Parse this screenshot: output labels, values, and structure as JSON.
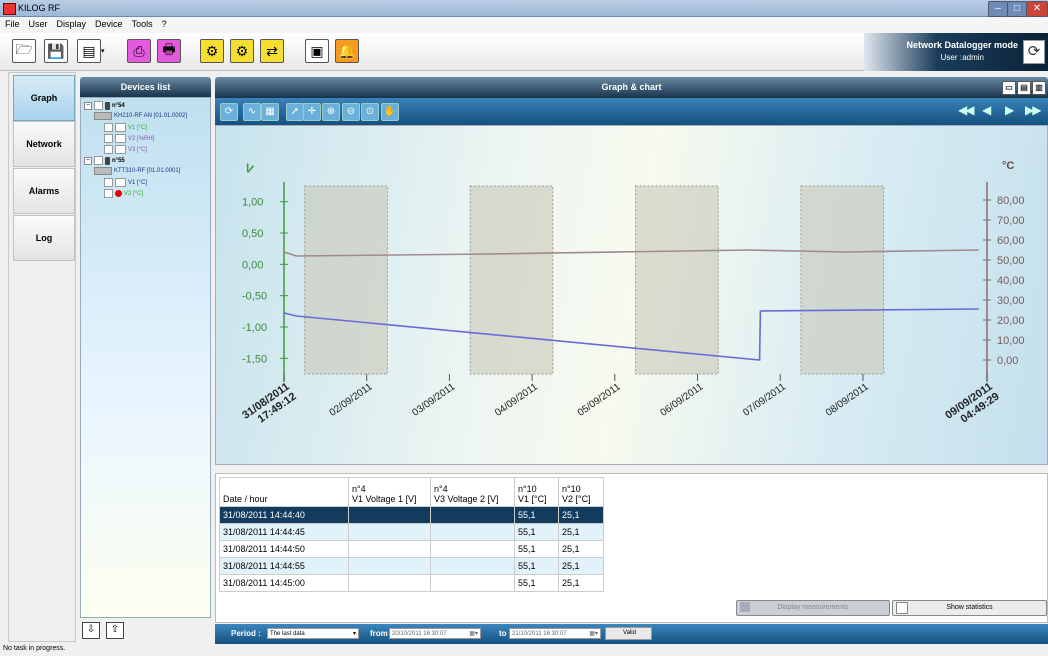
{
  "window": {
    "title": "KILOG RF",
    "buttons": [
      "–",
      "□",
      "✕"
    ]
  },
  "menu": [
    "File",
    "User",
    "Display",
    "Device",
    "Tools",
    "?"
  ],
  "header": {
    "mode": "Network Datalogger mode",
    "user_label": "User :",
    "user": "admin"
  },
  "left_nav": [
    "Graph",
    "Network",
    "Alarms",
    "Log"
  ],
  "devices": {
    "title": "Devices list",
    "nodes": [
      {
        "label": "n°54",
        "level": 0,
        "style": "bold"
      },
      {
        "label": "KH210-RF AN [01.01.0002]",
        "level": 1,
        "style": "bluetxt"
      },
      {
        "label": "V1 [°C]",
        "level": 2,
        "style": "green"
      },
      {
        "label": "V2 [%RH]",
        "level": 2,
        "style": "purple"
      },
      {
        "label": "V3 [°C]",
        "level": 2,
        "style": "purple"
      },
      {
        "label": "n°55",
        "level": 0,
        "style": "bold"
      },
      {
        "label": "KTT310-RF [01.01.0001]",
        "level": 1,
        "style": "bluetxt"
      },
      {
        "label": "V1 [°C]",
        "level": 2,
        "style": "bluetxt"
      },
      {
        "label": "V2 [°C]",
        "level": 2,
        "style": "green",
        "alarm": true
      }
    ]
  },
  "graph": {
    "title": "Graph & chart",
    "toolbar_icons": [
      "refresh-icon",
      "line-chart-icon",
      "table-chart-icon",
      "pointer-icon",
      "crosshair-icon",
      "zoom-in-icon",
      "zoom-out-icon",
      "zoom-fit-icon",
      "hand-icon"
    ],
    "nav_icons": [
      "first-icon",
      "previous-icon",
      "next-icon",
      "last-icon"
    ]
  },
  "chart_data": {
    "type": "line",
    "left_axis": {
      "unit": "V",
      "ylim": [
        -1.75,
        1.25
      ],
      "ticks": [
        "1,00",
        "0,50",
        "0,00",
        "-0,50",
        "-1,00",
        "-1,50"
      ],
      "tick_values": [
        1,
        0.5,
        0,
        -0.5,
        -1,
        -1.5
      ]
    },
    "right_axis": {
      "unit": "°C",
      "ylim": [
        -7,
        87
      ],
      "ticks": [
        "80,00",
        "70,00",
        "60,00",
        "50,00",
        "40,00",
        "30,00",
        "20,00",
        "10,00",
        "0,00"
      ],
      "tick_values": [
        80,
        70,
        60,
        50,
        40,
        30,
        20,
        10,
        0
      ]
    },
    "x_ticks": [
      {
        "t": 0,
        "label": [
          "31/08/2011",
          "17:49:12"
        ],
        "bold": true
      },
      {
        "t": 1,
        "label": [
          "02/09/2011"
        ]
      },
      {
        "t": 2,
        "label": [
          "03/09/2011"
        ]
      },
      {
        "t": 3,
        "label": [
          "04/09/2011"
        ]
      },
      {
        "t": 4,
        "label": [
          "05/09/2011"
        ]
      },
      {
        "t": 5,
        "label": [
          "06/09/2011"
        ]
      },
      {
        "t": 6,
        "label": [
          "07/09/2011"
        ]
      },
      {
        "t": 7,
        "label": [
          "08/09/2011"
        ]
      },
      {
        "t": 8.5,
        "label": [
          "09/09/2011",
          "04:49:29"
        ],
        "bold": true
      }
    ],
    "shaded_bands": [
      [
        0.25,
        1.25
      ],
      [
        2.25,
        3.25
      ],
      [
        4.25,
        5.25
      ],
      [
        6.25,
        7.25
      ]
    ],
    "series": [
      {
        "color": "#6a6ad8",
        "axis": "right",
        "points": [
          [
            0,
            23.5
          ],
          [
            0.15,
            22
          ],
          [
            5.75,
            0
          ],
          [
            5.76,
            24.5
          ],
          [
            8.4,
            25.5
          ]
        ]
      },
      {
        "color": "#a08a90",
        "axis": "right",
        "points": [
          [
            0,
            54
          ],
          [
            0.15,
            52
          ],
          [
            2.5,
            53
          ],
          [
            5.6,
            55
          ],
          [
            6.8,
            54
          ],
          [
            8.4,
            55
          ]
        ]
      }
    ]
  },
  "table": {
    "headers": [
      [
        "Date / hour"
      ],
      [
        "n°4",
        "V1 Voltage 1 [V]"
      ],
      [
        "n°4",
        "V3 Voltage 2 [V]"
      ],
      [
        "n°10",
        "V1 [°C]"
      ],
      [
        "n°10",
        "V2 [°C]"
      ]
    ],
    "rows": [
      [
        "31/08/2011 14:44:40",
        "",
        "",
        "55,1",
        "25,1"
      ],
      [
        "31/08/2011 14:44:45",
        "",
        "",
        "55,1",
        "25,1"
      ],
      [
        "31/08/2011 14:44:50",
        "",
        "",
        "55,1",
        "25,1"
      ],
      [
        "31/08/2011 14:44:55",
        "",
        "",
        "55,1",
        "25,1"
      ],
      [
        "31/08/2011 14:45:00",
        "",
        "",
        "55,1",
        "25,1"
      ]
    ],
    "display_measurements": "Display measurements",
    "show_statistics": "Show statistics"
  },
  "period": {
    "label": "Period :",
    "value": "The last data",
    "from_label": "from",
    "from_value": "20/10/2011 16:30:07",
    "to_label": "to",
    "to_value": "21/10/2011 16:30:07",
    "valid": "Valid"
  },
  "status": "No task in progress."
}
